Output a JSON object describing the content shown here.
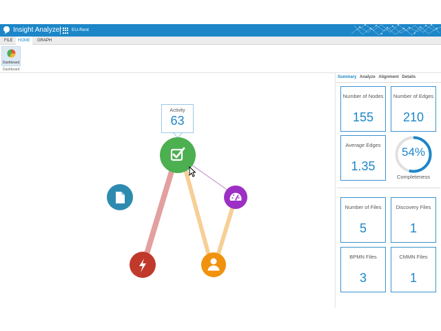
{
  "app": {
    "title": "Insight Analyzer",
    "project": "EU-Rent"
  },
  "menu": {
    "tabs": [
      {
        "label": "FILE",
        "active": false
      },
      {
        "label": "HOME",
        "active": true
      },
      {
        "label": "GRAPH",
        "active": false
      }
    ]
  },
  "ribbon": {
    "dashboard_label": "Dashboard",
    "group_label": "Dashboard"
  },
  "graph": {
    "tooltip": {
      "label": "Activity",
      "value": "63"
    },
    "nodes": [
      {
        "name": "activity",
        "icon": "checkbox-icon",
        "color": "#4caf50"
      },
      {
        "name": "document",
        "icon": "document-icon",
        "color": "#2e8bb0"
      },
      {
        "name": "dashboard",
        "icon": "gauge-icon",
        "color": "#9c30c4"
      },
      {
        "name": "event",
        "icon": "lightning-icon",
        "color": "#c0392b"
      },
      {
        "name": "user",
        "icon": "user-icon",
        "color": "#f0920e"
      }
    ],
    "edges": [
      {
        "from": "activity",
        "to": "event",
        "color": "#e3a0a0"
      },
      {
        "from": "activity",
        "to": "user",
        "color": "#f7cf95"
      },
      {
        "from": "activity",
        "to": "dashboard",
        "color": "#c29bd6"
      },
      {
        "from": "dashboard",
        "to": "user",
        "color": "#f7cf95"
      }
    ]
  },
  "panel": {
    "tabs": [
      {
        "label": "Summary",
        "active": true
      },
      {
        "label": "Analyze",
        "active": false
      },
      {
        "label": "Alignment",
        "active": false
      },
      {
        "label": "Details",
        "active": false
      }
    ],
    "nodes": {
      "label": "Number of Nodes",
      "value": "155"
    },
    "edges": {
      "label": "Number of Edges",
      "value": "210"
    },
    "avg_edges": {
      "label": "Average Edges",
      "value": "1.35"
    },
    "completeness": {
      "label": "Completeness",
      "value": "54%",
      "fraction": 0.54
    },
    "files": {
      "label": "Number of Files",
      "value": "5"
    },
    "discovery": {
      "label": "Discovery Files",
      "value": "1"
    },
    "bpmn": {
      "label": "BPMN Files",
      "value": "3"
    },
    "cmmn": {
      "label": "CMMN Files",
      "value": "1"
    }
  },
  "colors": {
    "accent": "#1c86c8",
    "card_border": "#3a91cf",
    "gauge_track": "#e0e0e0"
  }
}
